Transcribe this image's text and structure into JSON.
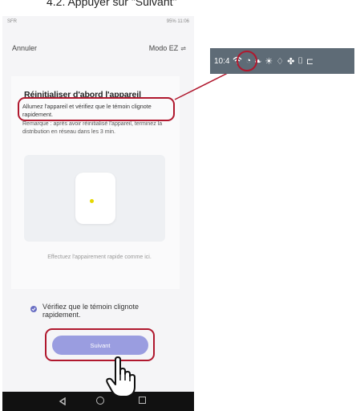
{
  "step": {
    "heading": "4.2. Appuyer sur \"Suivant\""
  },
  "status_bar": {
    "left": "SFR",
    "right": "95% 11:06"
  },
  "nav": {
    "cancel_label": "Annuler",
    "mode_label": "Modo EZ",
    "swap_icon": "swap-arrows-icon"
  },
  "card": {
    "title": "Réinitialiser d'abord l'appareil",
    "instruction": "Allumez l'appareil et vérifiez que le témoin clignote rapidement.",
    "note": "Remarque : après avoir réinitialisé l'appareil, terminez la distribution en réseau dans les 3 min.",
    "pairing_hint": "Effectuez l'appairement rapide comme ici."
  },
  "confirm": {
    "label": "Vérifiez que le témoin clignote rapidement.",
    "checked": true
  },
  "next_button": {
    "label": "Suivant"
  },
  "inset": {
    "time": "10:4",
    "icons": [
      "wifi-icon",
      "timer-icon",
      "leaf-icon",
      "sun-icon",
      "drop-icon",
      "fan-icon",
      "swing-icon",
      "plug-icon"
    ]
  },
  "colors": {
    "accent": "#9a9de0",
    "highlight": "#b0182e",
    "inset_bg": "#5e6b76"
  }
}
